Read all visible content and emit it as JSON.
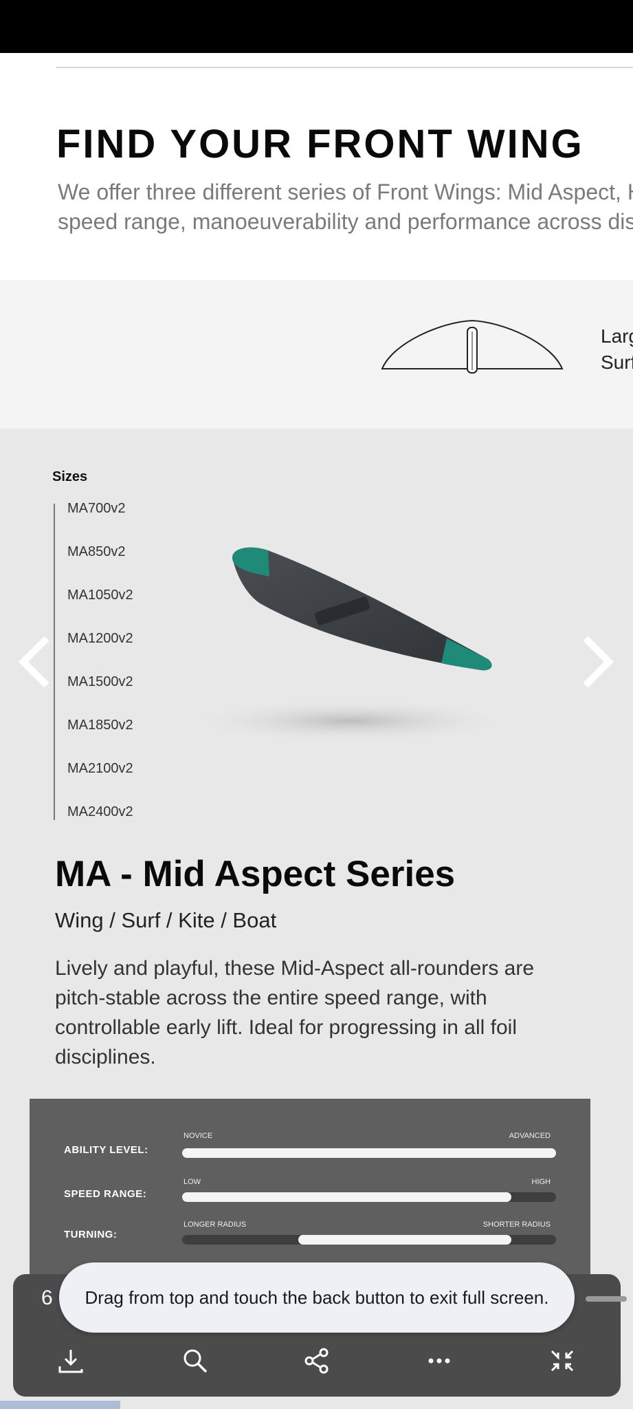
{
  "header": {
    "title": "FIND YOUR FRONT WING",
    "intro_line1": "We offer three different series of Front Wings: Mid Aspect, High Aspect and Surf",
    "intro_line2": "speed range, manoeuverability and performance across disciplines."
  },
  "selector": {
    "label_line1": "Large",
    "label_line2": "Surf"
  },
  "sizes": {
    "heading": "Sizes",
    "items": [
      "MA700v2",
      "MA850v2",
      "MA1050v2",
      "MA1200v2",
      "MA1500v2",
      "MA1850v2",
      "MA2100v2",
      "MA2400v2"
    ]
  },
  "product": {
    "title": "MA - Mid Aspect Series",
    "subtitle": "Wing / Surf / Kite / Boat",
    "description": "Lively and playful, these Mid-Aspect all-rounders are pitch-stable across the entire speed range, with controllable early lift. Ideal for progressing in all foil disciplines."
  },
  "specs": [
    {
      "label": "ABILITY LEVEL:",
      "min_label": "NOVICE",
      "max_label": "ADVANCED",
      "range_start": 0.0,
      "range_end": 1.0
    },
    {
      "label": "SPEED RANGE:",
      "min_label": "LOW",
      "max_label": "HIGH",
      "range_start": 0.0,
      "range_end": 0.88
    },
    {
      "label": "TURNING:",
      "min_label": "LONGER RADIUS",
      "max_label": "SHORTER RADIUS",
      "range_start": 0.31,
      "range_end": 0.88
    }
  ],
  "viewer": {
    "page_number": "6",
    "toast": "Drag from top and touch the back button to exit full screen.",
    "toolbar": [
      "download-icon",
      "search-icon",
      "share-icon",
      "more-icon",
      "exit-fullscreen-icon"
    ]
  },
  "colors": {
    "accent_teal": "#1f8a78",
    "wing_body": "#3b3f42",
    "spec_panel": "#5f5f5f"
  }
}
